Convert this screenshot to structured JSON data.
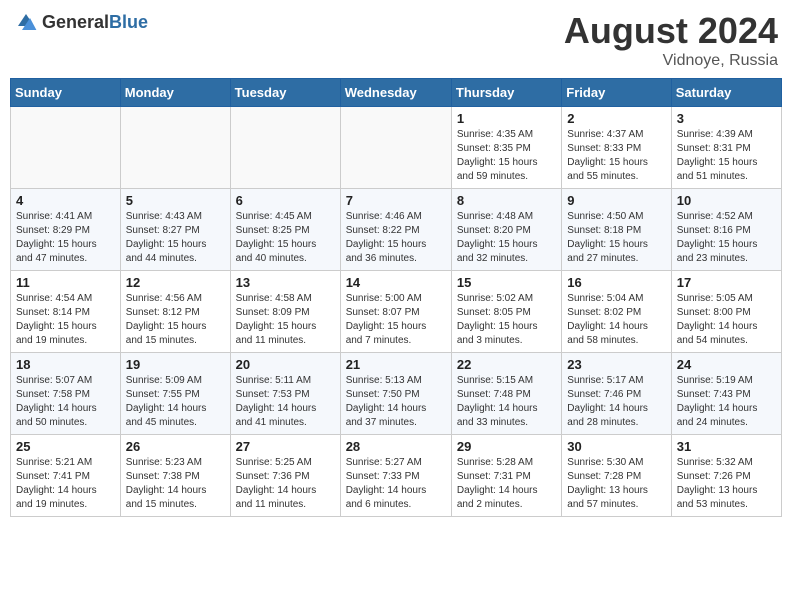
{
  "header": {
    "logo_general": "General",
    "logo_blue": "Blue",
    "month_year": "August 2024",
    "location": "Vidnoye, Russia"
  },
  "weekdays": [
    "Sunday",
    "Monday",
    "Tuesday",
    "Wednesday",
    "Thursday",
    "Friday",
    "Saturday"
  ],
  "weeks": [
    [
      {
        "day": "",
        "info": ""
      },
      {
        "day": "",
        "info": ""
      },
      {
        "day": "",
        "info": ""
      },
      {
        "day": "",
        "info": ""
      },
      {
        "day": "1",
        "info": "Sunrise: 4:35 AM\nSunset: 8:35 PM\nDaylight: 15 hours\nand 59 minutes."
      },
      {
        "day": "2",
        "info": "Sunrise: 4:37 AM\nSunset: 8:33 PM\nDaylight: 15 hours\nand 55 minutes."
      },
      {
        "day": "3",
        "info": "Sunrise: 4:39 AM\nSunset: 8:31 PM\nDaylight: 15 hours\nand 51 minutes."
      }
    ],
    [
      {
        "day": "4",
        "info": "Sunrise: 4:41 AM\nSunset: 8:29 PM\nDaylight: 15 hours\nand 47 minutes."
      },
      {
        "day": "5",
        "info": "Sunrise: 4:43 AM\nSunset: 8:27 PM\nDaylight: 15 hours\nand 44 minutes."
      },
      {
        "day": "6",
        "info": "Sunrise: 4:45 AM\nSunset: 8:25 PM\nDaylight: 15 hours\nand 40 minutes."
      },
      {
        "day": "7",
        "info": "Sunrise: 4:46 AM\nSunset: 8:22 PM\nDaylight: 15 hours\nand 36 minutes."
      },
      {
        "day": "8",
        "info": "Sunrise: 4:48 AM\nSunset: 8:20 PM\nDaylight: 15 hours\nand 32 minutes."
      },
      {
        "day": "9",
        "info": "Sunrise: 4:50 AM\nSunset: 8:18 PM\nDaylight: 15 hours\nand 27 minutes."
      },
      {
        "day": "10",
        "info": "Sunrise: 4:52 AM\nSunset: 8:16 PM\nDaylight: 15 hours\nand 23 minutes."
      }
    ],
    [
      {
        "day": "11",
        "info": "Sunrise: 4:54 AM\nSunset: 8:14 PM\nDaylight: 15 hours\nand 19 minutes."
      },
      {
        "day": "12",
        "info": "Sunrise: 4:56 AM\nSunset: 8:12 PM\nDaylight: 15 hours\nand 15 minutes."
      },
      {
        "day": "13",
        "info": "Sunrise: 4:58 AM\nSunset: 8:09 PM\nDaylight: 15 hours\nand 11 minutes."
      },
      {
        "day": "14",
        "info": "Sunrise: 5:00 AM\nSunset: 8:07 PM\nDaylight: 15 hours\nand 7 minutes."
      },
      {
        "day": "15",
        "info": "Sunrise: 5:02 AM\nSunset: 8:05 PM\nDaylight: 15 hours\nand 3 minutes."
      },
      {
        "day": "16",
        "info": "Sunrise: 5:04 AM\nSunset: 8:02 PM\nDaylight: 14 hours\nand 58 minutes."
      },
      {
        "day": "17",
        "info": "Sunrise: 5:05 AM\nSunset: 8:00 PM\nDaylight: 14 hours\nand 54 minutes."
      }
    ],
    [
      {
        "day": "18",
        "info": "Sunrise: 5:07 AM\nSunset: 7:58 PM\nDaylight: 14 hours\nand 50 minutes."
      },
      {
        "day": "19",
        "info": "Sunrise: 5:09 AM\nSunset: 7:55 PM\nDaylight: 14 hours\nand 45 minutes."
      },
      {
        "day": "20",
        "info": "Sunrise: 5:11 AM\nSunset: 7:53 PM\nDaylight: 14 hours\nand 41 minutes."
      },
      {
        "day": "21",
        "info": "Sunrise: 5:13 AM\nSunset: 7:50 PM\nDaylight: 14 hours\nand 37 minutes."
      },
      {
        "day": "22",
        "info": "Sunrise: 5:15 AM\nSunset: 7:48 PM\nDaylight: 14 hours\nand 33 minutes."
      },
      {
        "day": "23",
        "info": "Sunrise: 5:17 AM\nSunset: 7:46 PM\nDaylight: 14 hours\nand 28 minutes."
      },
      {
        "day": "24",
        "info": "Sunrise: 5:19 AM\nSunset: 7:43 PM\nDaylight: 14 hours\nand 24 minutes."
      }
    ],
    [
      {
        "day": "25",
        "info": "Sunrise: 5:21 AM\nSunset: 7:41 PM\nDaylight: 14 hours\nand 19 minutes."
      },
      {
        "day": "26",
        "info": "Sunrise: 5:23 AM\nSunset: 7:38 PM\nDaylight: 14 hours\nand 15 minutes."
      },
      {
        "day": "27",
        "info": "Sunrise: 5:25 AM\nSunset: 7:36 PM\nDaylight: 14 hours\nand 11 minutes."
      },
      {
        "day": "28",
        "info": "Sunrise: 5:27 AM\nSunset: 7:33 PM\nDaylight: 14 hours\nand 6 minutes."
      },
      {
        "day": "29",
        "info": "Sunrise: 5:28 AM\nSunset: 7:31 PM\nDaylight: 14 hours\nand 2 minutes."
      },
      {
        "day": "30",
        "info": "Sunrise: 5:30 AM\nSunset: 7:28 PM\nDaylight: 13 hours\nand 57 minutes."
      },
      {
        "day": "31",
        "info": "Sunrise: 5:32 AM\nSunset: 7:26 PM\nDaylight: 13 hours\nand 53 minutes."
      }
    ]
  ]
}
